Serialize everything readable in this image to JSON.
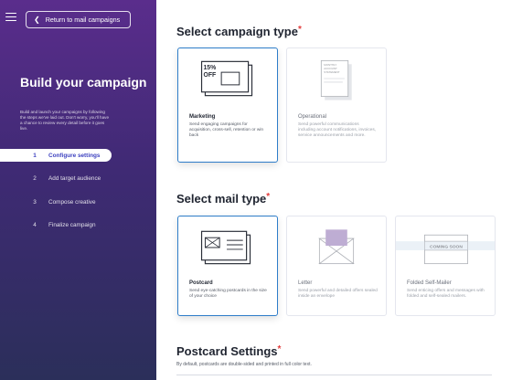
{
  "sidebar": {
    "return_label": "Return to mail campaigns",
    "title": "Build your campaign",
    "description": "Build and launch your campaigns by following the steps we've laid out. Don't worry, you'll have a chance to review every detail before it goes live.",
    "steps": [
      {
        "num": "1",
        "label": "Configure settings",
        "active": true
      },
      {
        "num": "2",
        "label": "Add target audience",
        "active": false
      },
      {
        "num": "3",
        "label": "Compose creative",
        "active": false
      },
      {
        "num": "4",
        "label": "Finalize campaign",
        "active": false
      }
    ]
  },
  "campaign_type": {
    "title": "Select campaign type",
    "required": "*",
    "options": [
      {
        "name": "Marketing",
        "desc": "Send engaging campaigns for acquisition, cross-sell, retention or win back",
        "selected": true,
        "badge": "15% OFF"
      },
      {
        "name": "Operational",
        "desc": "Send powerful communications including account notifications, invoices, service announcements and more.",
        "selected": false,
        "doc_text": "MONTHLY ACCOUNT STATEMENT"
      }
    ]
  },
  "mail_type": {
    "title": "Select mail type",
    "required": "*",
    "options": [
      {
        "name": "Postcard",
        "desc": "Send eye-catching postcards in the size of your choice",
        "selected": true
      },
      {
        "name": "Letter",
        "desc": "Send powerful and detailed offers sealed inside an envelope",
        "selected": false
      },
      {
        "name": "Folded Self-Mailer",
        "desc": "Send enticing offers and messages with folded and self-sealed mailers.",
        "selected": false,
        "badge": "COMING SOON"
      }
    ]
  },
  "postcard_settings": {
    "title": "Postcard Settings",
    "required": "*",
    "subtitle": "By default, postcards are double-sided and printed in full color text."
  },
  "colors": {
    "accent": "#2e7dc9",
    "required": "#e23b3b",
    "active_step_text": "#3b3fbf",
    "sidebar_top": "#5a2d8c",
    "sidebar_bottom": "#2b2f5a",
    "envelope": "#8a6bb0"
  }
}
